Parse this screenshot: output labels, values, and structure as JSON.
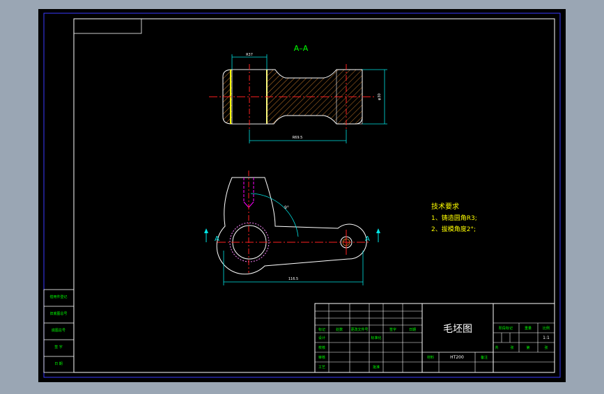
{
  "colors": {
    "background": "#9aa6b4",
    "canvas": "#000000",
    "frame": "#3a3aff",
    "part": "#ffffff",
    "hatch": "#c87a2a",
    "centerline": "#ff2020",
    "dimension": "#00e5e5",
    "text_yellow": "#ffff00",
    "text_green": "#00ff00",
    "hidden": "#ff00ff",
    "title_grid": "#ffffff"
  },
  "section_title": "A–A",
  "dimensions": {
    "top_left_width": "R37",
    "top_height": "φ30",
    "top_length": "R69.5",
    "bottom_length": "116.5",
    "angle": "9°"
  },
  "section_markers": {
    "left": "A",
    "right": "A"
  },
  "tech_requirements": {
    "heading": "技术要求",
    "line1": "1、铸造圆角R3;",
    "line2": "2、拔模角度2°;"
  },
  "left_stamp": {
    "row1": "借用件登记",
    "row2": "旧底图总号",
    "row3": "底图总号",
    "row4": "签 字",
    "row5": "日 期"
  },
  "title_block": {
    "drawing_name": "毛坯图",
    "material": "HT200",
    "col_mark": "标记",
    "col_count": "处数",
    "col_file": "更改文件号",
    "col_sign": "签字",
    "col_date": "日期",
    "row_design": "设计",
    "row_check": "校核",
    "row_audit": "审核",
    "row_process": "工艺",
    "standard": "标准化",
    "approve": "批准",
    "stage_label": "阶段标记",
    "weight_label": "重量",
    "scale_label": "比例",
    "scale_value": "1:1",
    "sheet_total": "共",
    "sheet_label": "张",
    "sheet_num": "第",
    "sheet_unit": "张",
    "material_label": "材料",
    "remark_label": "备注"
  }
}
